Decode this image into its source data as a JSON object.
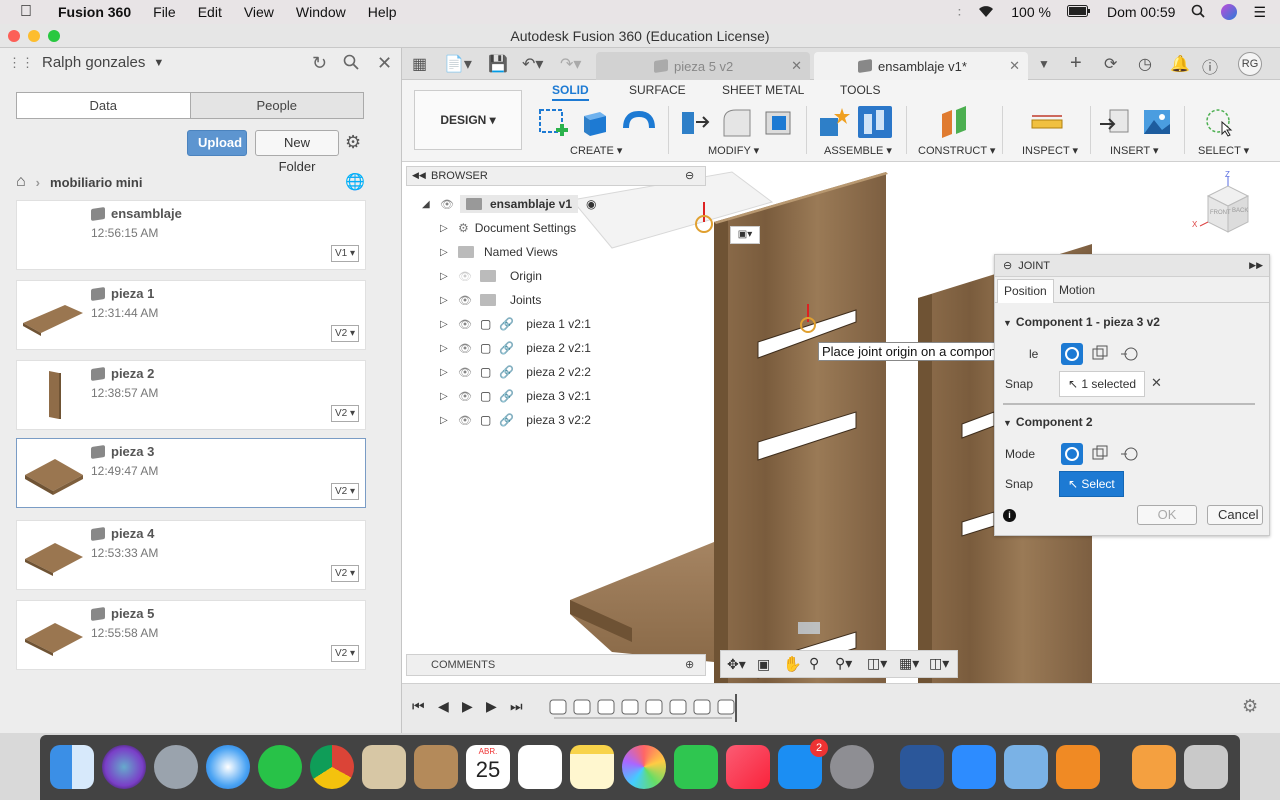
{
  "menubar": {
    "app": "Fusion 360",
    "items": [
      "File",
      "Edit",
      "View",
      "Window",
      "Help"
    ],
    "battery": "100 %",
    "clock": "Dom 00:59"
  },
  "window": {
    "title": "Autodesk Fusion 360 (Education License)"
  },
  "data_panel": {
    "user": "Ralph gonzales",
    "tabs": [
      "Data",
      "People"
    ],
    "upload_label": "Upload",
    "new_folder_label": "New Folder",
    "breadcrumb": "mobiliario mini",
    "files": [
      {
        "name": "ensamblaje",
        "time": "12:56:15 AM",
        "version": "V1"
      },
      {
        "name": "pieza 1",
        "time": "12:31:44 AM",
        "version": "V2"
      },
      {
        "name": "pieza 2",
        "time": "12:38:57 AM",
        "version": "V2"
      },
      {
        "name": "pieza 3",
        "time": "12:49:47 AM",
        "version": "V2"
      },
      {
        "name": "pieza 4",
        "time": "12:53:33 AM",
        "version": "V2"
      },
      {
        "name": "pieza 5",
        "time": "12:55:58 AM",
        "version": "V2"
      }
    ]
  },
  "doc_tabs": [
    {
      "label": "pieza 5 v2"
    },
    {
      "label": "ensamblaje v1*"
    }
  ],
  "avatar_initials": "RG",
  "ribbon": {
    "workspace": "DESIGN",
    "tabs": [
      "SOLID",
      "SURFACE",
      "SHEET METAL",
      "TOOLS"
    ],
    "groups": [
      "CREATE",
      "MODIFY",
      "ASSEMBLE",
      "CONSTRUCT",
      "INSPECT",
      "INSERT",
      "SELECT"
    ]
  },
  "browser": {
    "title": "BROWSER",
    "root": "ensamblaje v1",
    "items": [
      {
        "label": "Document Settings"
      },
      {
        "label": "Named Views"
      },
      {
        "label": "Origin"
      },
      {
        "label": "Joints"
      },
      {
        "label": "pieza 1 v2:1"
      },
      {
        "label": "pieza 2 v2:1"
      },
      {
        "label": "pieza 2 v2:2"
      },
      {
        "label": "pieza 3 v2:1"
      },
      {
        "label": "pieza 3 v2:2"
      }
    ]
  },
  "tooltip": "Place joint origin on a component",
  "joint_dialog": {
    "title": "JOINT",
    "tabs": [
      "Position",
      "Motion"
    ],
    "component1_title": "Component 1 - pieza 3 v2",
    "component2_title": "Component 2",
    "mode_label": "Mode",
    "mode_label_partial": "le",
    "snap_label": "Snap",
    "snap1_value": "1 selected",
    "snap2_value": "Select",
    "ok_label": "OK",
    "cancel_label": "Cancel"
  },
  "comments_label": "COMMENTS",
  "viewcube": {
    "front": "FRONT",
    "back": "BACK",
    "axis_x": "X",
    "axis_z": "Z"
  },
  "dock_badge": "2",
  "calendar": {
    "month": "ABR.",
    "day": "25"
  },
  "colors": {
    "accent": "#1d7ad3",
    "upload": "#5d95d0",
    "wood": "#8a6a48"
  }
}
